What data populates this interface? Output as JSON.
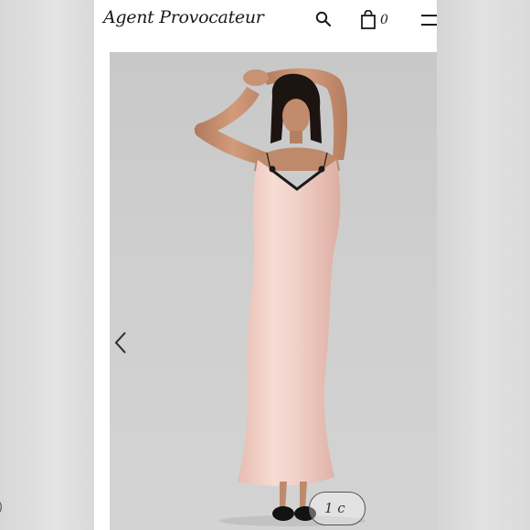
{
  "header": {
    "brand": "Agent Provocateur",
    "icons": [
      "search-icon",
      "shopping-bag-icon",
      "hamburger-menu-icon"
    ],
    "bag_count": "0"
  },
  "gallery": {
    "controls": [
      "chevron-left-icon",
      "chevron-right-icon",
      "heart-icon"
    ],
    "image_counter": "1 c",
    "left_fragment": ")"
  },
  "colors": {
    "dress": "#f0cfc6",
    "lace_trim": "#1a1a1a",
    "background": "#cfcfcf"
  }
}
